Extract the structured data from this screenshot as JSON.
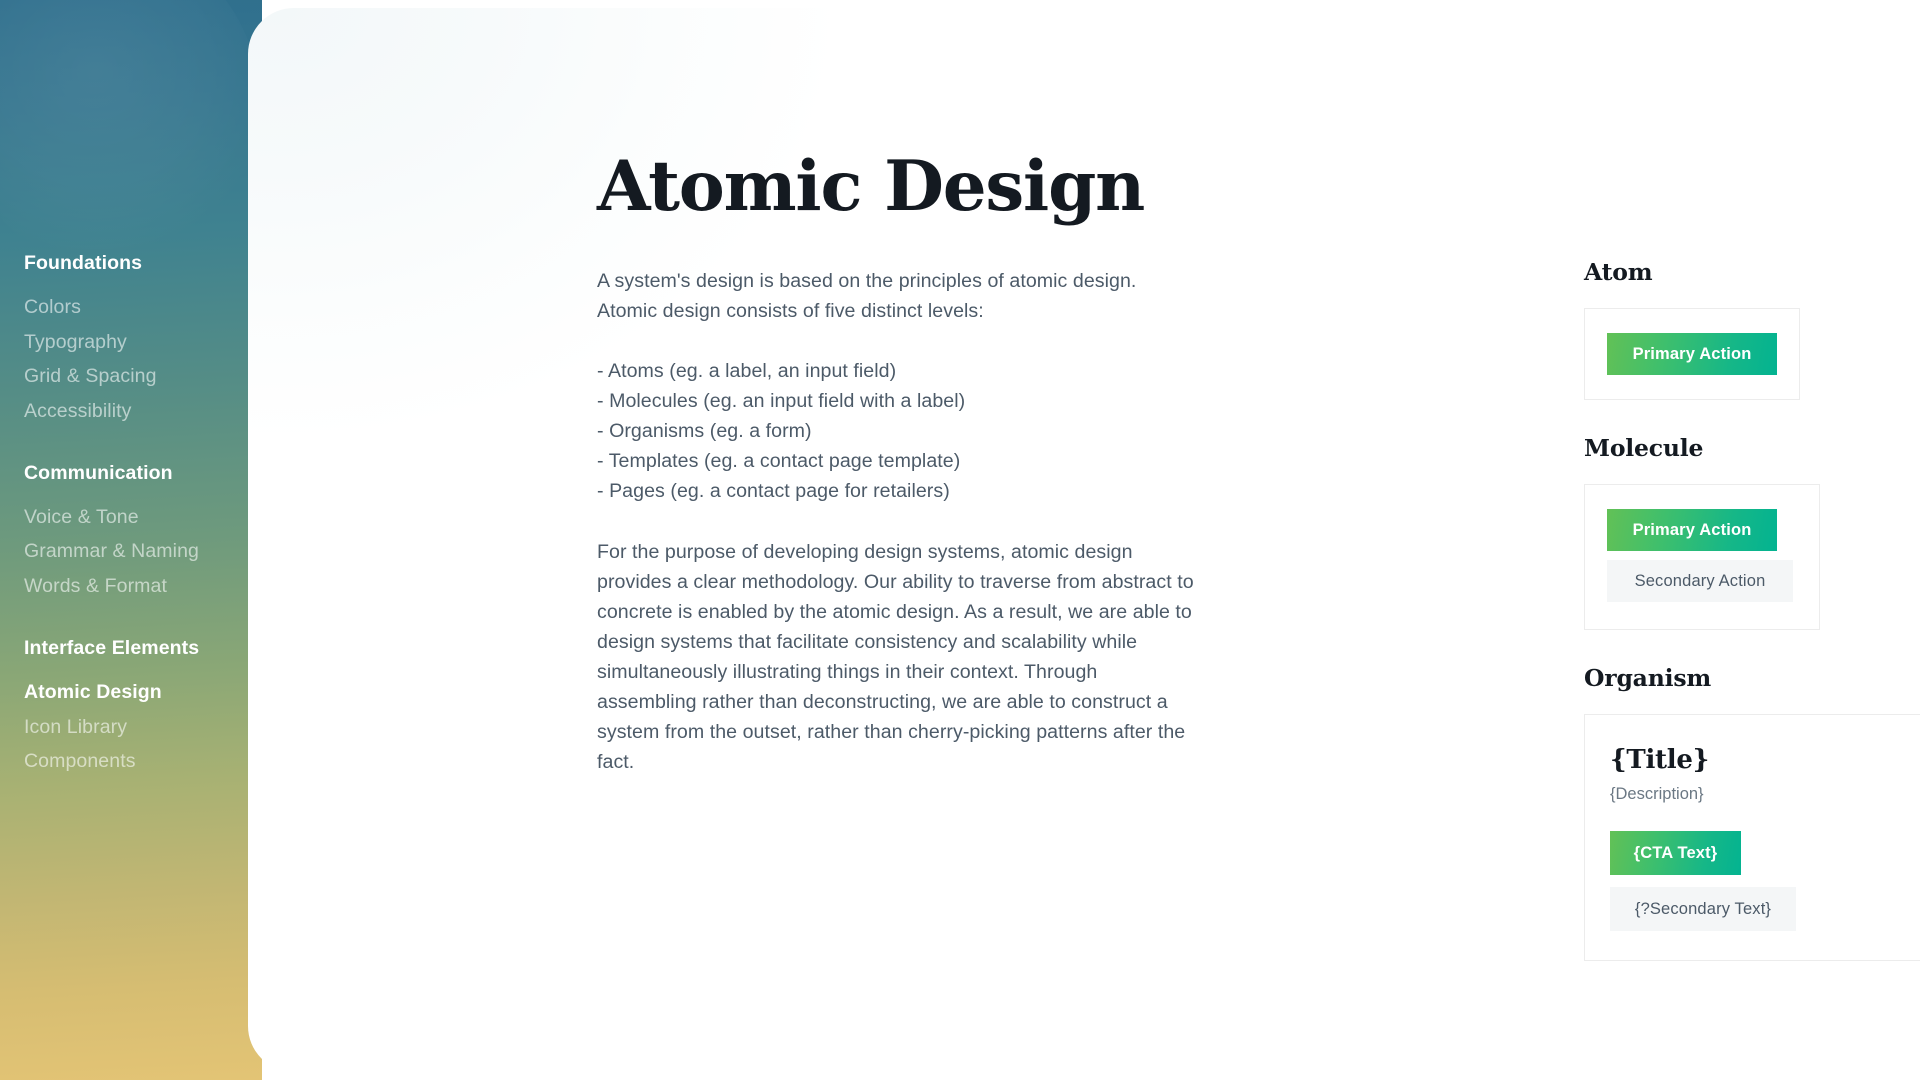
{
  "sidebar": {
    "groups": [
      {
        "heading": "Foundations",
        "items": [
          {
            "label": "Colors",
            "active": false
          },
          {
            "label": "Typography",
            "active": false
          },
          {
            "label": "Grid & Spacing",
            "active": false
          },
          {
            "label": "Accessibility",
            "active": false
          }
        ]
      },
      {
        "heading": "Communication",
        "items": [
          {
            "label": "Voice & Tone",
            "active": false
          },
          {
            "label": "Grammar & Naming",
            "active": false
          },
          {
            "label": "Words & Format",
            "active": false
          }
        ]
      },
      {
        "heading": "Interface Elements",
        "items": [
          {
            "label": "Atomic Design",
            "active": true
          },
          {
            "label": "Icon Library",
            "active": false
          },
          {
            "label": "Components",
            "active": false
          }
        ]
      }
    ]
  },
  "article": {
    "title": "Atomic Design",
    "intro_line_1": "A system's design is based on the principles of atomic design.",
    "intro_line_2": "Atomic design consists of five distinct levels:",
    "levels": [
      "- Atoms (eg. a label, an input field)",
      "- Molecules (eg. an input field with a label)",
      "- Organisms (eg. a form)",
      "- Templates (eg. a contact page template)",
      "- Pages (eg. a contact page for retailers)"
    ],
    "closing_paragraph": "For the purpose of developing design systems, atomic design provides a clear methodology. Our ability to traverse from abstract to concrete is enabled by the atomic design. As a result, we are able to design systems that facilitate consistency and scalability while simultaneously illustrating things in their context. Through assembling rather than deconstructing, we are able to construct a system from the outset, rather than cherry-picking patterns after the fact."
  },
  "showcase": {
    "atom": {
      "label": "Atom",
      "primary_action": "Primary Action"
    },
    "molecule": {
      "label": "Molecule",
      "primary_action": "Primary Action",
      "secondary_action": "Secondary Action"
    },
    "organism": {
      "label": "Organism",
      "title": "{Title}",
      "description": "{Description}",
      "cta": "{CTA Text}",
      "secondary_cta": "{?Secondary Text}"
    }
  },
  "colors": {
    "primary_gradient_start": "#62c156",
    "primary_gradient_end": "#03b391",
    "sidebar_gradient_start": "#2f6f8d",
    "sidebar_gradient_end": "#e3c475",
    "body_text": "#4c5a68",
    "heading_text": "#141a21",
    "secondary_button_bg": "#f4f6f7",
    "card_border": "#ececec"
  }
}
